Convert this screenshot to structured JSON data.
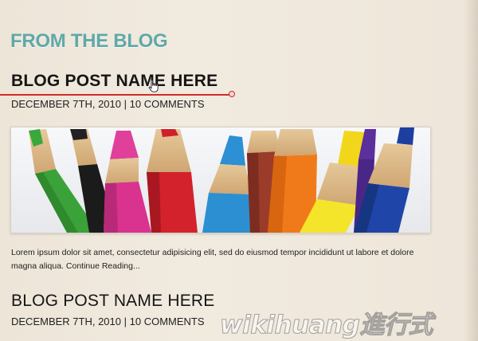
{
  "section": {
    "title": "FROM THE BLOG"
  },
  "posts": [
    {
      "title": "BLOG POST NAME HERE",
      "date": "DECEMBER 7TH, 2010",
      "separator": "|",
      "comments": "10 COMMENTS",
      "image_alt": "colored-pencils-photo",
      "excerpt": "Lorem ipsum dolor sit amet, consectetur adipisicing elit, sed do eiusmod tempor incididunt ut labore et dolore magna aliqua.",
      "continue_label": "Continue Reading..."
    },
    {
      "title": "BLOG POST NAME HERE",
      "date": "DECEMBER 7TH, 2010",
      "separator": "|",
      "comments": "10 COMMENTS"
    }
  ],
  "watermark": {
    "text": "wikihuang進行式"
  },
  "colors": {
    "background": "#efe7da",
    "section_title": "#5fa9a8",
    "annotation": "#d22a2a",
    "text": "#151515"
  },
  "icons": {
    "cursor": "hand-pointer-icon",
    "annotation": "red-underline-annotation"
  }
}
